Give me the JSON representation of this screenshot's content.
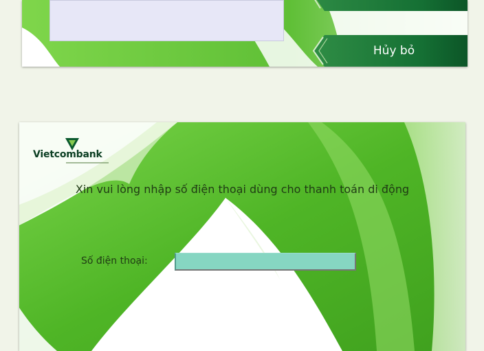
{
  "top_screen": {
    "prev_button_label": "",
    "cancel_button_label": "Hủy bỏ",
    "info_box_text": ""
  },
  "main_screen": {
    "brand": "Vietcombank",
    "prompt": "Xin vui lòng nhập số điện thoại dùng cho thanh toán di động",
    "phone_field": {
      "label": "Số điện thoại:",
      "value": "",
      "placeholder": ""
    }
  },
  "colors": {
    "page_background": "#f1f4e9",
    "screen_green": "#58bb2e",
    "button_green": "#17703a",
    "input_fill": "#86d6c2",
    "brand_dark_green": "#0b3e22"
  },
  "icons": {
    "logo_mark": "vietcombank-logo-icon",
    "button_arrow": "chevron-left-icon"
  }
}
